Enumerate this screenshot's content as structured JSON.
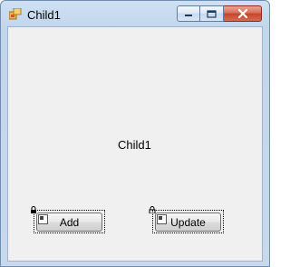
{
  "window": {
    "title": "Child1",
    "icon": "forms-app-icon",
    "caption_buttons": [
      "minimize-icon",
      "maximize-icon",
      "close-icon"
    ]
  },
  "client": {
    "center_label": "Child1",
    "buttons": {
      "add": "Add",
      "update": "Update"
    }
  },
  "colors": {
    "client_bg": "#f0f0f0",
    "close_red": "#c7432b",
    "frame_blue": "#c2d6ec"
  }
}
